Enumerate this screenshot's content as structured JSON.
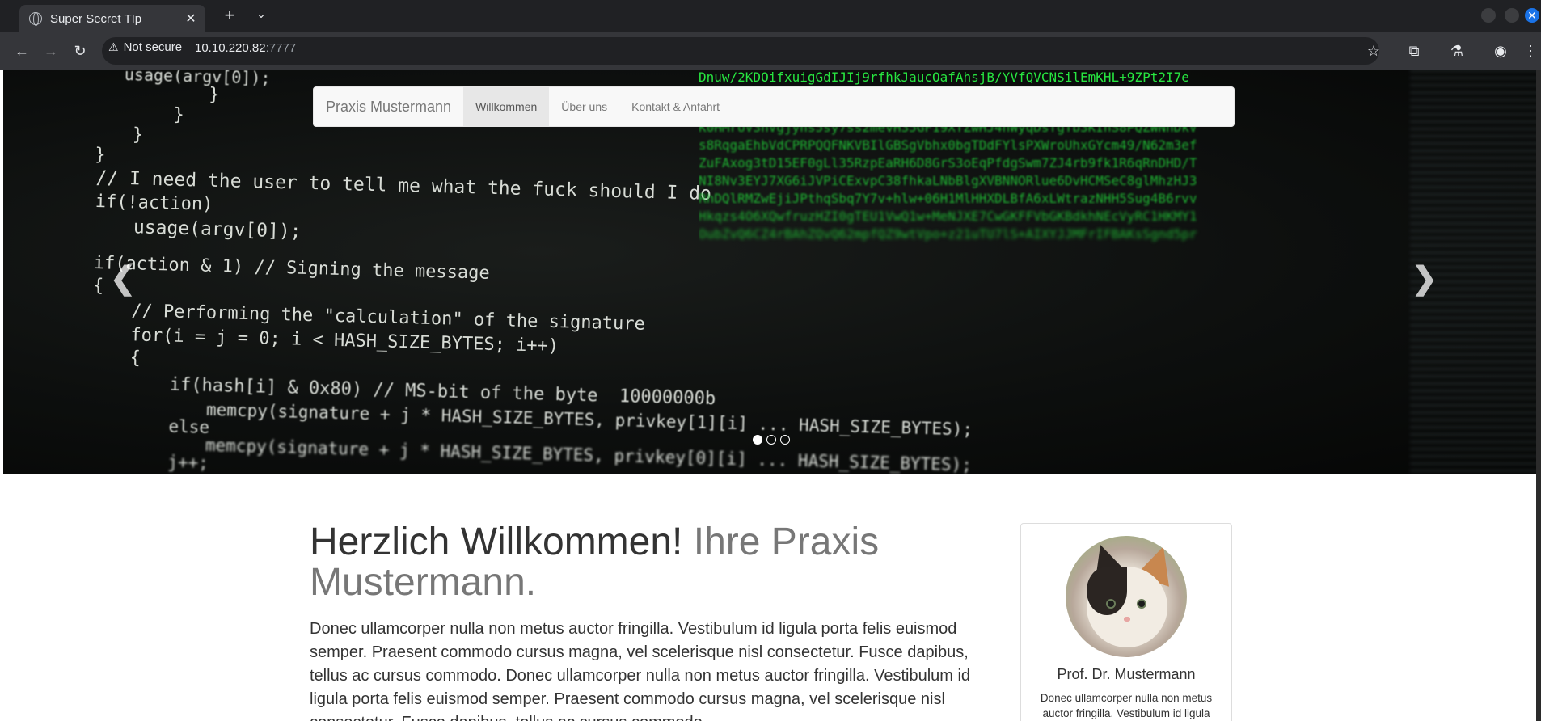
{
  "browser": {
    "tab_title": "Super Secret TIp",
    "security_label": "Not secure",
    "url_host": "10.10.220.82",
    "url_port": ":7777"
  },
  "navbar": {
    "brand": "Praxis Mustermann",
    "links": [
      "Willkommen",
      "Über uns",
      "Kontakt & Anfahrt"
    ],
    "active_link": "Willkommen"
  },
  "hero": {
    "code_lines": {
      "l1": "usage(argv[0]);",
      "l2": "}",
      "l3": "}",
      "l4": "}",
      "l5": "}",
      "comment1": "// I need the user to tell me what the fuck should I do",
      "l7a": "if(!action)",
      "l8": "usage(argv[0]);",
      "l9": "if(action & 1) // Signing the message",
      "l10": "{",
      "comment2": "// Performing the \"calculation\" of the signature",
      "l12": "for(i = j = 0; i < HASH_SIZE_BYTES; i++)",
      "l13": "{",
      "l14": "if(hash[i] & 0x80) // MS-bit of the byte  10000000b",
      "l15": "memcpy(signature + j * HASH_SIZE_BYTES, privkey[1][i] ... HASH_SIZE_BYTES);",
      "l16": "else",
      "l17": "memcpy(signature + j * HASH_SIZE_BYTES, privkey[0][i] ... HASH_SIZE_BYTES);",
      "l18": "j++;"
    },
    "green_lines": [
      "Dnuw/2KDOifxuigGdIJIj9rfhkJaucOafAhsjB/YVfQVCNSilEmKHL+9ZPt2I7e",
      "K0HMrUV3hVgjyns5sy7ss2mevH35GF19XTZwHJ4hWyqDsfgTb3KInS8PQZWNhDkV",
      "s8RqgaEhbVdCPRPQQFNKVBIlGBSgVbhx0bgTDdFYlsPXWroUhxGYcm49/N62m3ef",
      "ZuFAxog3tD15EF0gLl35RzpEaRH6D8GrS3oEqPfdgSwm7ZJ4rb9fk1R6qRnDHD/T",
      "NI8Nv3EYJ7XG6iJVPiCExvpC38fhkaLNbBlgXVBNNORlue6DvHCMSeC8glMhzHJ3",
      "RhDQlRMZwEjiJPthqSbq7Y7v+hlw+06H1MlHHXDLBfA6xLWtrazNHH5Sug4B6rvv",
      "Hkqzs4O6XQwfruzHZI0gTEU1VwQ1w+MeNJXE7CwGKFFVbGKBdkhNEcVyRC1HKMY1",
      "OubZvQ6CZ4rBAhZQvQ62mpfQZ9wtVpo+z21uTU7lS+AIXYJJMFrIFBAKsSgnd5pr"
    ],
    "slide_count": 3,
    "active_slide": 1
  },
  "main": {
    "heading_strong": "Herzlich Willkommen!",
    "heading_muted": "Ihre Praxis Mustermann.",
    "lead": "Donec ullamcorper nulla non metus auctor fringilla. Vestibulum id ligula porta felis euismod semper. Praesent commodo cursus magna, vel scelerisque nisl consectetur. Fusce dapibus, tellus ac cursus commodo. Donec ullamcorper nulla non metus auctor fringilla. Vestibulum id ligula porta felis euismod semper. Praesent commodo cursus magna, vel scelerisque nisl consectetur. Fusce dapibus, tellus ac cursus commodo."
  },
  "profile": {
    "name": "Prof. Dr. Mustermann",
    "text": "Donec ullamcorper nulla non metus auctor fringilla. Vestibulum id ligula"
  },
  "colors": {
    "navbar_bg": "#f8f8f8",
    "green_code": "#27e640",
    "browser_chrome": "#35363a"
  }
}
